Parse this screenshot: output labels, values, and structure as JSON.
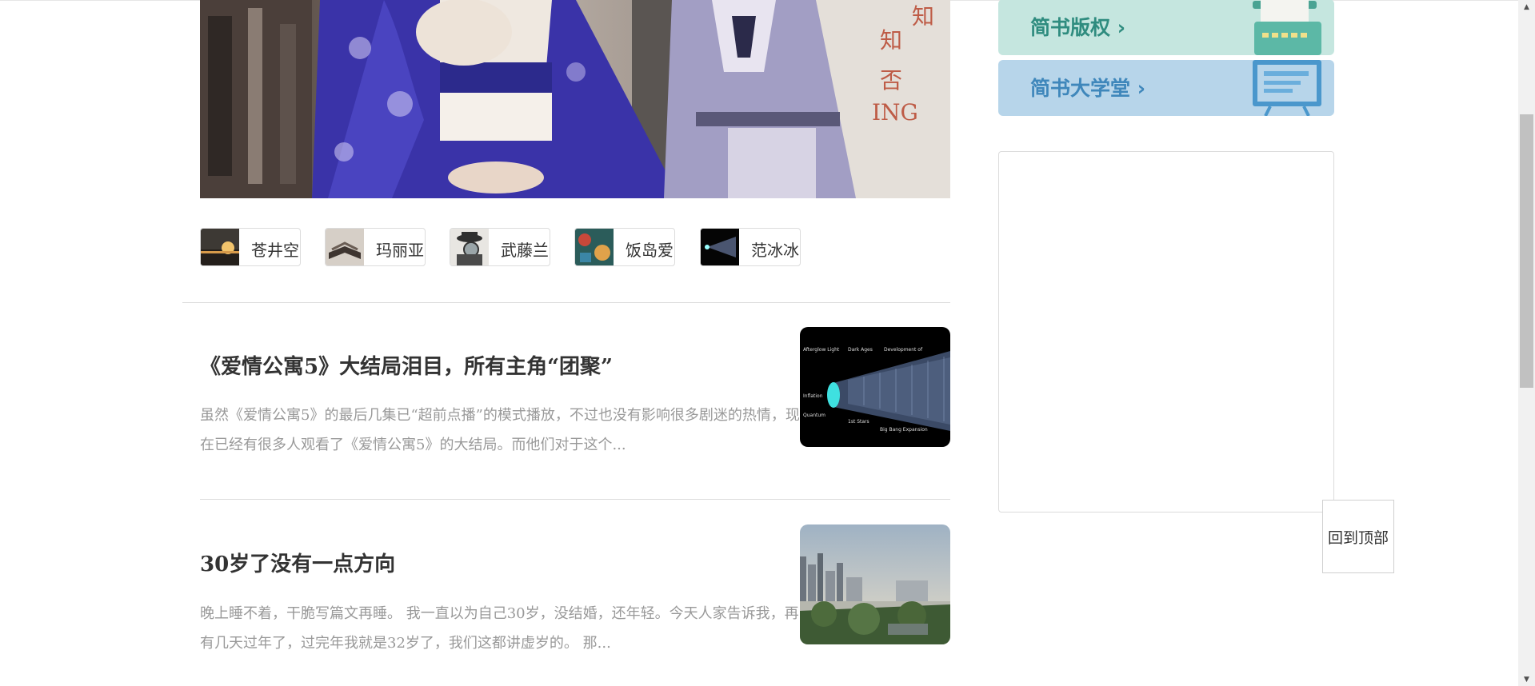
{
  "hero": {
    "image_alt": "drama-poster"
  },
  "categories": [
    {
      "label": "苍井空",
      "thumb": "sunset-bird"
    },
    {
      "label": "玛丽亚",
      "thumb": "open-book"
    },
    {
      "label": "武藤兰",
      "thumb": "detective-magnifier"
    },
    {
      "label": "饭岛爱",
      "thumb": "colorful-painting"
    },
    {
      "label": "范冰冰",
      "thumb": "universe-diagram"
    }
  ],
  "articles": [
    {
      "title": "《爱情公寓5》大结局泪目，所有主角“团聚”",
      "abstract": "虽然《爱情公寓5》的最后几集已“超前点播”的模式播放，不过也没有影响很多剧迷的热情，现在已经有很多人观看了《爱情公寓5》的大结局。而他们对于这个...",
      "image": "universe-timeline"
    },
    {
      "title": "30岁了没有一点方向",
      "abstract": "晚上睡不着，干脆写篇文再睡。 我一直以为自己30岁，没结婚，还年轻。今天人家告诉我，再有几天过年了，过完年我就是32岁了，我们这都讲虚岁的。 那...",
      "image": "city-skyline"
    }
  ],
  "sidebar": {
    "copyright_label": "简书版权",
    "college_label": "简书大学堂",
    "chevron": "›",
    "back_to_top": "回到顶部"
  },
  "colors": {
    "copyright_bg": "#c5e6df",
    "college_bg": "#b7d5ea",
    "title": "#333333",
    "abstract": "#999999"
  },
  "icons": [
    "typewriter-icon",
    "presentation-board-icon",
    "scroll-up-arrow",
    "scroll-down-arrow"
  ]
}
